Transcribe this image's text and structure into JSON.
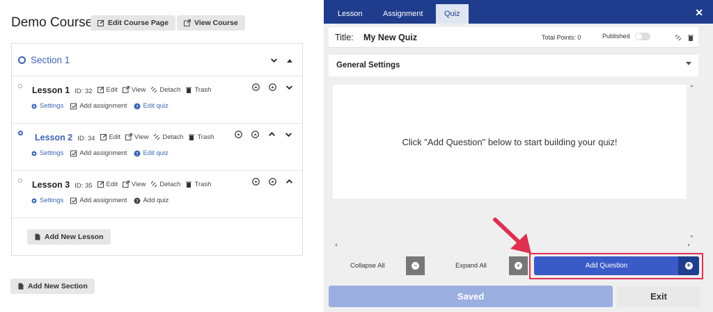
{
  "course": {
    "title": "Demo Course",
    "edit_page_label": "Edit Course Page",
    "view_course_label": "View Course"
  },
  "section": {
    "name": "Section 1"
  },
  "lessons": [
    {
      "name": "Lesson 1",
      "id": "ID: 32",
      "edit": "Edit",
      "view": "View",
      "detach": "Detach",
      "trash": "Trash",
      "settings": "Settings",
      "assignment": "Add assignment",
      "quiz": "Edit quiz"
    },
    {
      "name": "Lesson 2",
      "id": "ID: 34",
      "edit": "Edit",
      "view": "View",
      "detach": "Detach",
      "trash": "Trash",
      "settings": "Settings",
      "assignment": "Add assignment",
      "quiz": "Edit quiz"
    },
    {
      "name": "Lesson 3",
      "id": "ID: 35",
      "edit": "Edit",
      "view": "View",
      "detach": "Detach",
      "trash": "Trash",
      "settings": "Settings",
      "assignment": "Add assignment",
      "quiz": "Add quiz"
    }
  ],
  "add_lesson_label": "Add New Lesson",
  "add_section_label": "Add New Section",
  "panel": {
    "tabs": [
      "Lesson",
      "Assignment",
      "Quiz"
    ],
    "active_tab": "Quiz",
    "title_label": "Title:",
    "title_value": "My New Quiz",
    "total_points": "Total Points: 0",
    "published_label": "Published",
    "general_settings": "General Settings",
    "empty_message": "Click \"Add Question\" below to start building your quiz!",
    "collapse_all": "Collapse All",
    "expand_all": "Expand All",
    "add_question": "Add Question",
    "saved_label": "Saved",
    "exit_label": "Exit"
  },
  "colors": {
    "brand_blue": "#1f3d8c",
    "link_blue": "#3d64b5",
    "add_question_blue": "#3a5bc7",
    "highlight_red": "#e03050"
  }
}
